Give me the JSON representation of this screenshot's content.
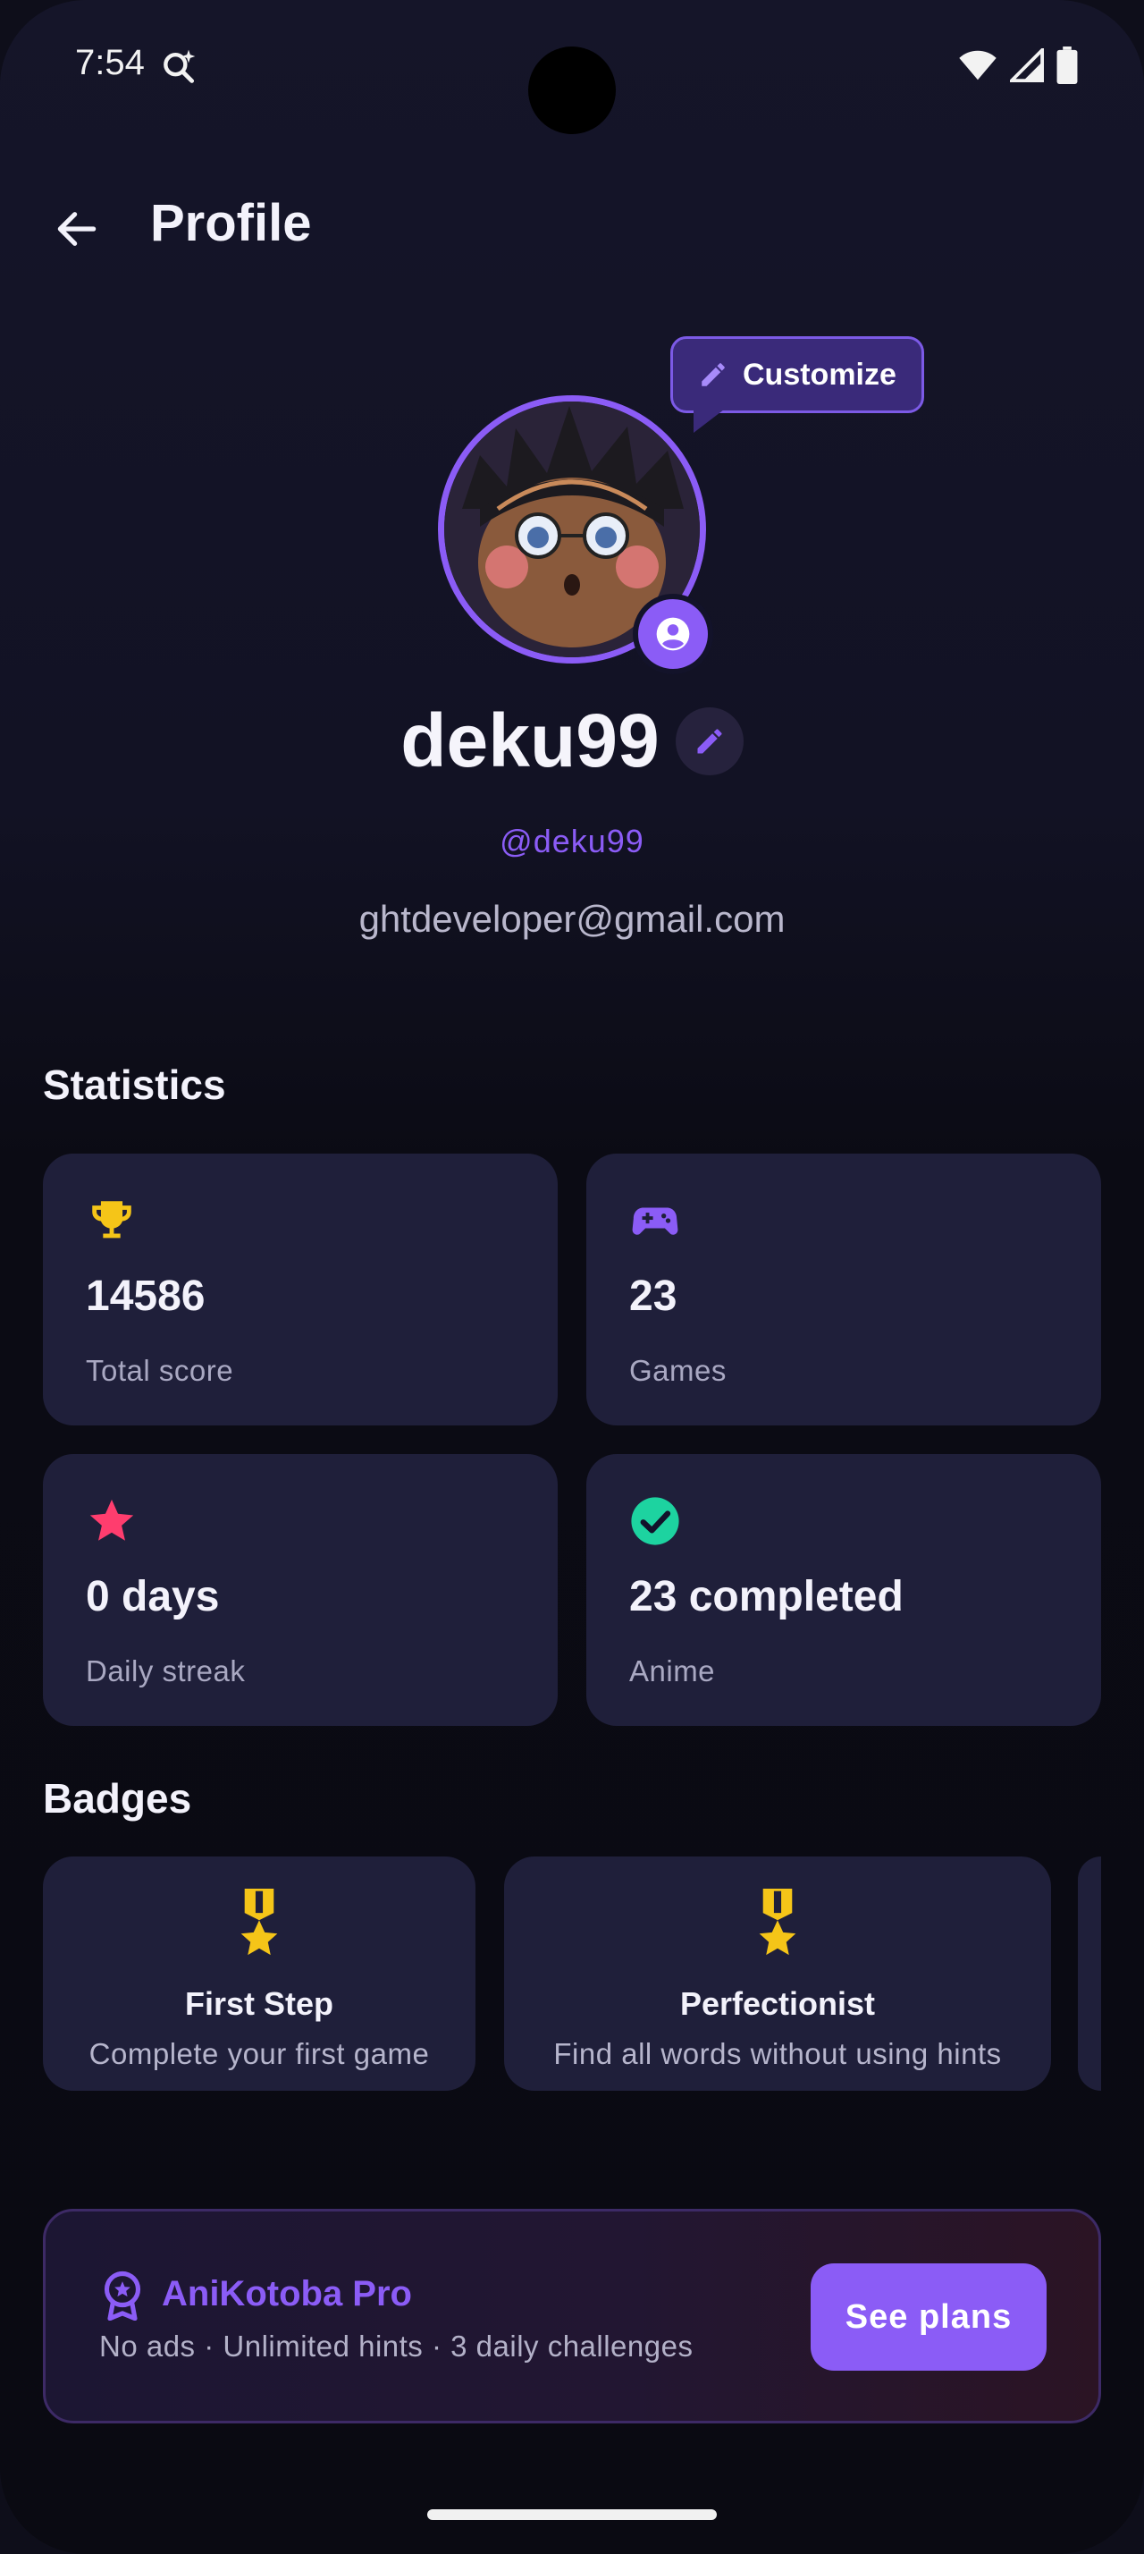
{
  "status_bar": {
    "time": "7:54"
  },
  "header": {
    "title": "Profile"
  },
  "profile": {
    "customize_label": "Customize",
    "username": "deku99",
    "handle": "@deku99",
    "email": "ghtdeveloper@gmail.com"
  },
  "statistics": {
    "title": "Statistics",
    "items": [
      {
        "value": "14586",
        "label": "Total score",
        "icon": "trophy-icon",
        "color": "#f5c518"
      },
      {
        "value": "23",
        "label": "Games",
        "icon": "gamepad-icon",
        "color": "#8b5cf6"
      },
      {
        "value": "0 days",
        "label": "Daily streak",
        "icon": "star-icon",
        "color": "#ff3d6e"
      },
      {
        "value": "23 completed",
        "label": "Anime",
        "icon": "check-circle-icon",
        "color": "#1dd3a0"
      }
    ]
  },
  "badges": {
    "title": "Badges",
    "items": [
      {
        "name": "First Step",
        "description": "Complete your first game",
        "icon": "medal-icon"
      },
      {
        "name": "Perfectionist",
        "description": "Find all words without using hints",
        "icon": "medal-icon"
      }
    ]
  },
  "pro": {
    "title": "AniKotoba Pro",
    "description": "No ads · Unlimited hints · 3 daily challenges",
    "button": "See plans"
  },
  "colors": {
    "accent": "#8b5cf6",
    "card": "#1f1f3a",
    "background": "#0e0e1a"
  }
}
